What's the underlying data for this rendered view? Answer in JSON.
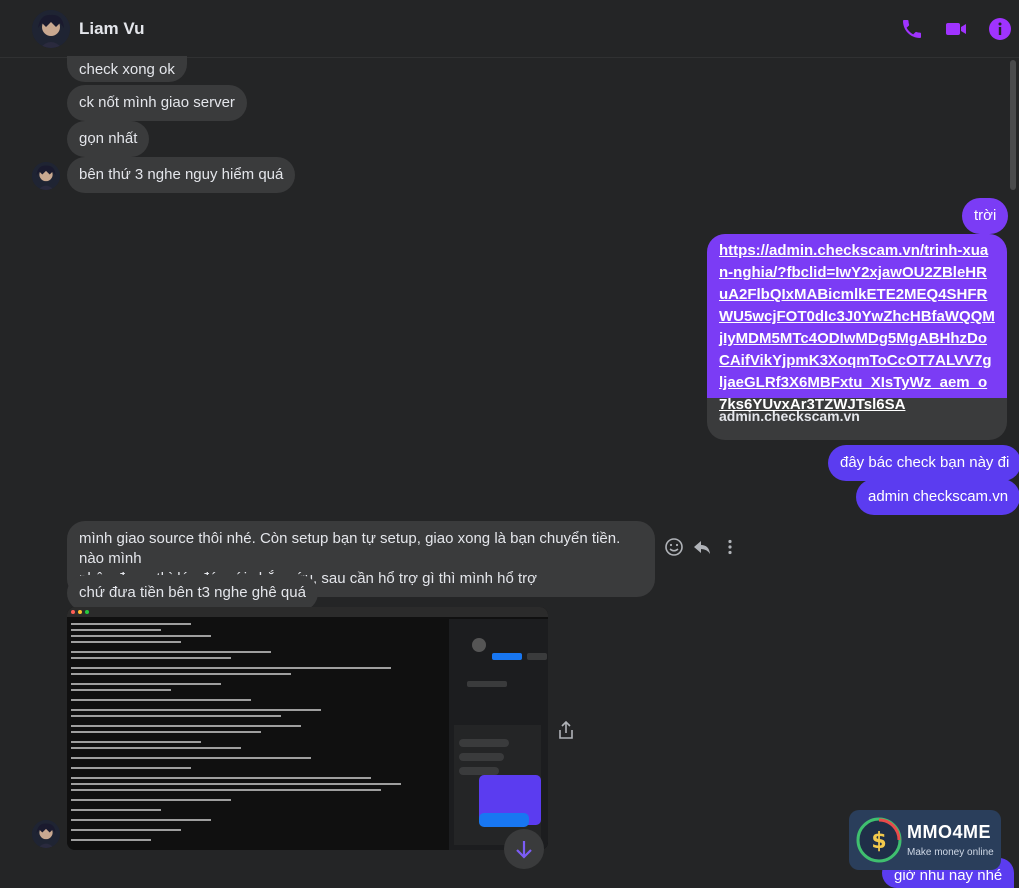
{
  "header": {
    "contact_name": "Liam Vu",
    "icons": [
      "phone-icon",
      "video-call-icon",
      "info-icon"
    ],
    "accent_color": "#a033ff"
  },
  "messages": {
    "in_1": "check xong ok",
    "in_2": "ck nốt mình giao server",
    "in_3": "gọn nhất",
    "in_4": "bên thứ 3 nghe nguy hiểm quá",
    "out_1": "trời",
    "out_link_url": "https://admin.checkscam.vn/trinh-xuan-nghia/?fbclid=IwY2xjawOU2ZBleHRuA2FlbQIxMABicmlkETE2MEQ4SHFRWU5wcjFOT0dIc3J0YwZhcHBfaWQQMjIyMDM5MTc4ODIwMDg5MgABHhzDoCAifVikYjpmK3XoqmToCcOT7ALVV7gljaeGLRf3X6MBFxtu_XIsTyWz_aem_o7ks6YUvxAr3TZWJTsl6SA",
    "out_link_domain": "admin.checkscam.vn",
    "out_2": "đây bác check bạn này đi",
    "out_3": "admin checkscam.vn",
    "in_5_line1": "mình giao source thôi nhé. Còn setup bạn tự setup, giao xong là bạn chuyển tiền. nào mình",
    "in_5_line2": "nhận được thì lúc đó mới chắc cứu, sau cần hổ trợ gì thì mình hổ trợ",
    "in_6": "chứ đưa tiền bên t3 nghe ghê quá",
    "out_4": "giờ nhu nay nhé"
  },
  "actions": {
    "icons": [
      "emoji-react-icon",
      "reply-icon",
      "more-options-icon",
      "share-icon",
      "scroll-down-icon"
    ]
  },
  "watermark": {
    "title": "MMO4ME",
    "subtitle": "Make money online"
  },
  "colors": {
    "background": "#242526",
    "incoming_bubble": "#3a3b3c",
    "outgoing_bubble": "#7b3cf5"
  }
}
